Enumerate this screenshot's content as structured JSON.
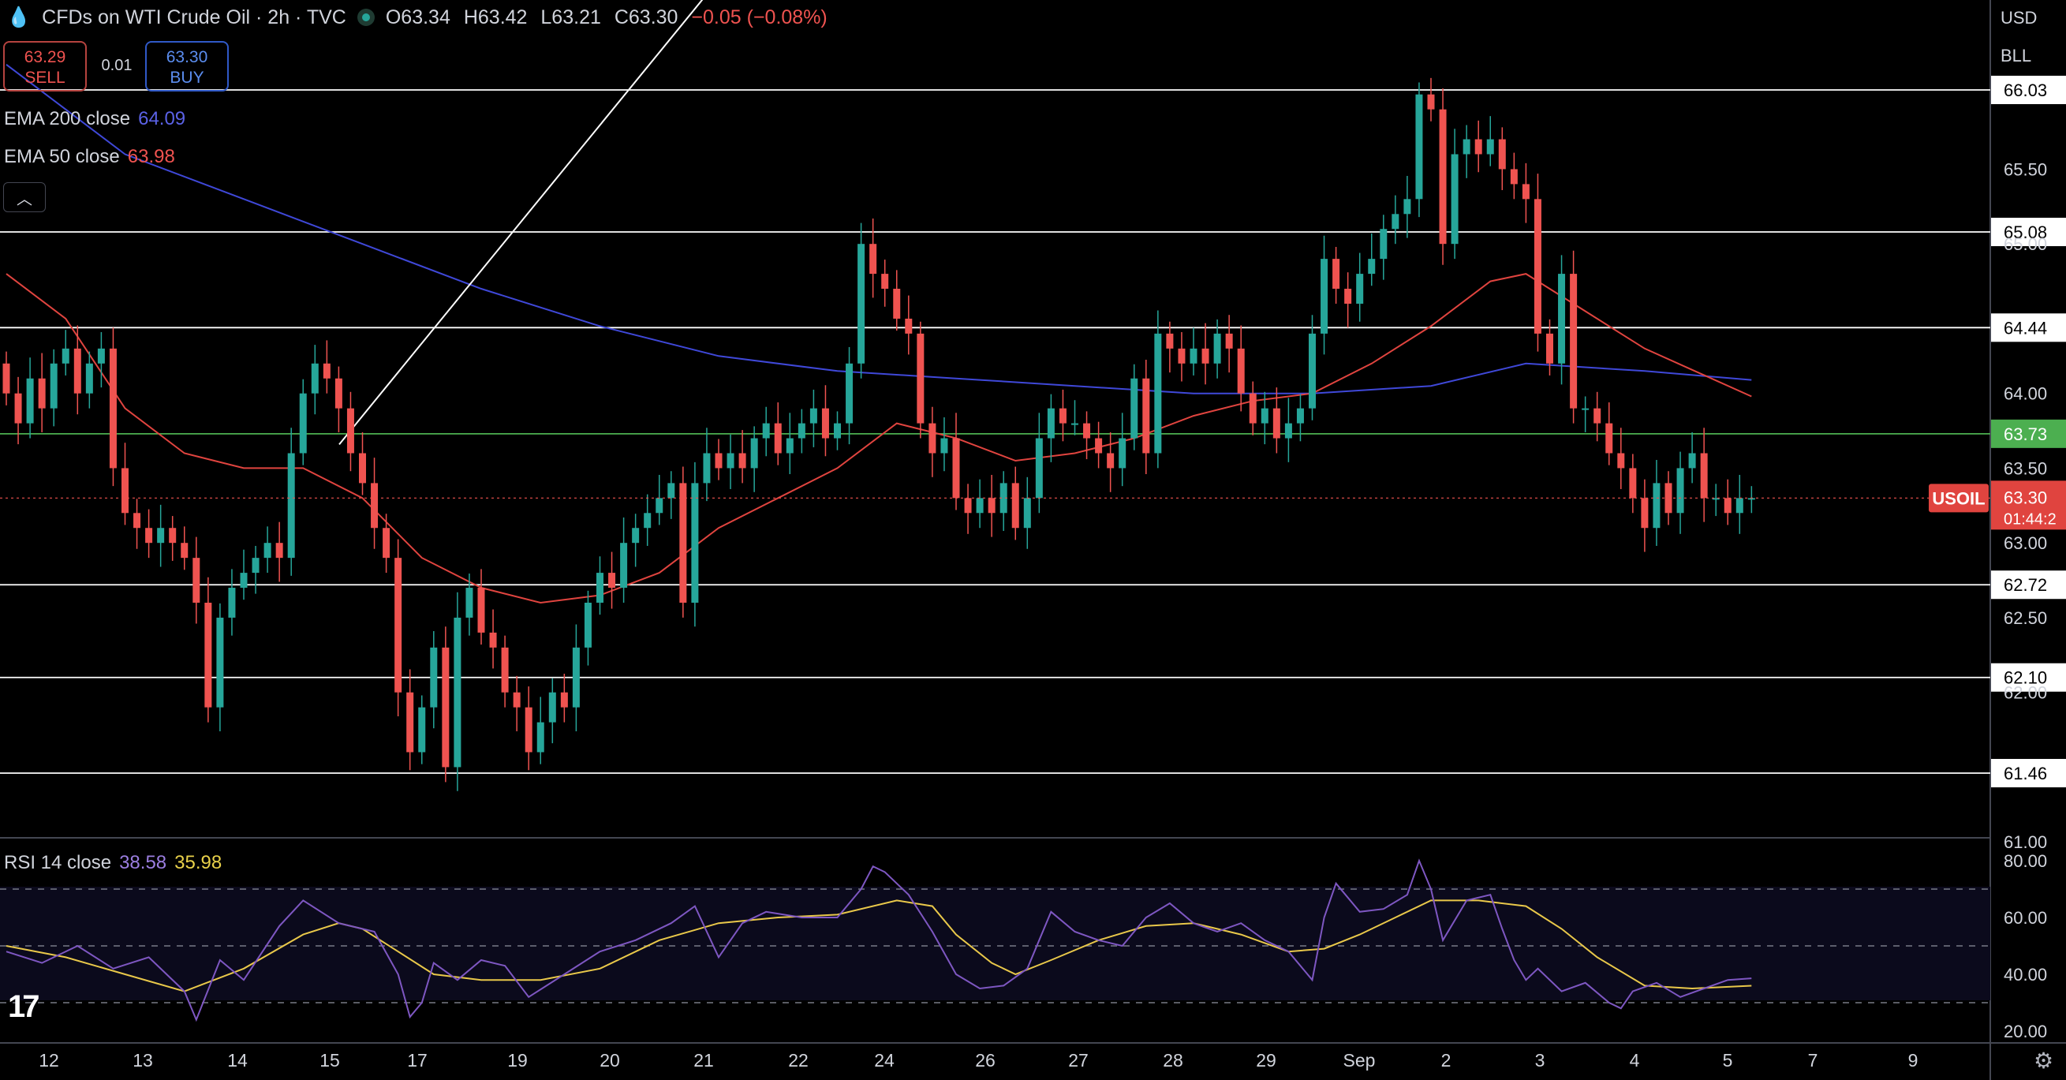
{
  "header": {
    "title": "CFDs on WTI Crude Oil · 2h · TVC",
    "open": "O63.34",
    "high": "H63.42",
    "low": "L63.21",
    "close": "C63.30",
    "change": "−0.05 (−0.08%)"
  },
  "trade": {
    "sell_price": "63.29",
    "sell_label": "SELL",
    "spread": "0.01",
    "buy_price": "63.30",
    "buy_label": "BUY"
  },
  "indicators": {
    "ema200": {
      "label": "EMA 200 close",
      "value": "64.09"
    },
    "ema50": {
      "label": "EMA 50 close",
      "value": "63.98"
    },
    "rsi": {
      "label": "RSI 14 close",
      "value": "38.58",
      "ma": "35.98"
    }
  },
  "axis_top": {
    "currency": "USD",
    "unit": "BLL"
  },
  "colors": {
    "up": "#26a69a",
    "down": "#ef5350",
    "ema200": "#3f48d8",
    "ema50": "#e0443f",
    "rsi": "#7e57c2",
    "rsi_ma": "#e9c84a",
    "support": "#4caf50"
  },
  "chart_data": {
    "type": "candlestick",
    "symbol": "USOIL",
    "last_price": "63.30",
    "countdown": "01:44:2",
    "price_ticks": [
      "65.50",
      "65.00",
      "64.00",
      "63.50",
      "63.00",
      "62.50",
      "62.00",
      "61.00"
    ],
    "rsi_ticks": [
      "80.00",
      "60.00",
      "40.00",
      "20.00"
    ],
    "rsi_levels": [
      70,
      50,
      30
    ],
    "levels": [
      {
        "value": "66.03",
        "y": 66.03,
        "color": "#ffffff"
      },
      {
        "value": "65.08",
        "y": 65.08,
        "color": "#ffffff"
      },
      {
        "value": "64.44",
        "y": 64.44,
        "color": "#ffffff"
      },
      {
        "value": "63.73",
        "y": 63.73,
        "color": "#4caf50"
      },
      {
        "value": "62.72",
        "y": 62.72,
        "color": "#ffffff"
      },
      {
        "value": "62.10",
        "y": 62.1,
        "color": "#ffffff"
      },
      {
        "value": "61.46",
        "y": 61.46,
        "color": "#ffffff"
      }
    ],
    "x_labels": [
      "12",
      "13",
      "14",
      "15",
      "17",
      "19",
      "20",
      "21",
      "22",
      "24",
      "26",
      "27",
      "28",
      "29",
      "Sep",
      "2",
      "3",
      "4",
      "5",
      "7",
      "9"
    ],
    "trendline": [
      [
        0.5,
        60.98
      ],
      [
        44.4,
        65.25
      ]
    ],
    "candles": [
      [
        64.2,
        64.0
      ],
      [
        64.0,
        63.8
      ],
      [
        63.8,
        64.1
      ],
      [
        64.1,
        63.9
      ],
      [
        63.9,
        64.2
      ],
      [
        64.2,
        64.3
      ],
      [
        64.3,
        64.0
      ],
      [
        64.0,
        64.2
      ],
      [
        64.2,
        64.3
      ],
      [
        64.3,
        63.5
      ],
      [
        63.5,
        63.2
      ],
      [
        63.2,
        63.1
      ],
      [
        63.1,
        63.0
      ],
      [
        63.0,
        63.1
      ],
      [
        63.1,
        63.0
      ],
      [
        63.0,
        62.9
      ],
      [
        62.9,
        62.6
      ],
      [
        62.6,
        61.9
      ],
      [
        61.9,
        62.5
      ],
      [
        62.5,
        62.7
      ],
      [
        62.7,
        62.8
      ],
      [
        62.8,
        62.9
      ],
      [
        62.9,
        63.0
      ],
      [
        63.0,
        62.9
      ],
      [
        62.9,
        63.6
      ],
      [
        63.6,
        64.0
      ],
      [
        64.0,
        64.2
      ],
      [
        64.2,
        64.1
      ],
      [
        64.1,
        63.9
      ],
      [
        63.9,
        63.6
      ],
      [
        63.6,
        63.4
      ],
      [
        63.4,
        63.1
      ],
      [
        63.1,
        62.9
      ],
      [
        62.9,
        62.0
      ],
      [
        62.0,
        61.6
      ],
      [
        61.6,
        61.9
      ],
      [
        61.9,
        62.3
      ],
      [
        62.3,
        61.5
      ],
      [
        61.5,
        62.5
      ],
      [
        62.5,
        62.7
      ],
      [
        62.7,
        62.4
      ],
      [
        62.4,
        62.3
      ],
      [
        62.3,
        62.0
      ],
      [
        62.0,
        61.9
      ],
      [
        61.9,
        61.6
      ],
      [
        61.6,
        61.8
      ],
      [
        61.8,
        62.0
      ],
      [
        62.0,
        61.9
      ],
      [
        61.9,
        62.3
      ],
      [
        62.3,
        62.6
      ],
      [
        62.6,
        62.8
      ],
      [
        62.8,
        62.7
      ],
      [
        62.7,
        63.0
      ],
      [
        63.0,
        63.1
      ],
      [
        63.1,
        63.2
      ],
      [
        63.2,
        63.3
      ],
      [
        63.3,
        63.4
      ],
      [
        63.4,
        62.6
      ],
      [
        62.6,
        63.4
      ],
      [
        63.4,
        63.6
      ],
      [
        63.6,
        63.5
      ],
      [
        63.5,
        63.6
      ],
      [
        63.6,
        63.5
      ],
      [
        63.5,
        63.7
      ],
      [
        63.7,
        63.8
      ],
      [
        63.8,
        63.6
      ],
      [
        63.6,
        63.7
      ],
      [
        63.7,
        63.8
      ],
      [
        63.8,
        63.9
      ],
      [
        63.9,
        63.7
      ],
      [
        63.7,
        63.8
      ],
      [
        63.8,
        64.2
      ],
      [
        64.2,
        65.0
      ],
      [
        65.0,
        64.8
      ],
      [
        64.8,
        64.7
      ],
      [
        64.7,
        64.5
      ],
      [
        64.5,
        64.4
      ],
      [
        64.4,
        63.8
      ],
      [
        63.8,
        63.6
      ],
      [
        63.6,
        63.7
      ],
      [
        63.7,
        63.3
      ],
      [
        63.3,
        63.2
      ],
      [
        63.2,
        63.3
      ],
      [
        63.3,
        63.2
      ],
      [
        63.2,
        63.4
      ],
      [
        63.4,
        63.1
      ],
      [
        63.1,
        63.3
      ],
      [
        63.3,
        63.7
      ],
      [
        63.7,
        63.9
      ],
      [
        63.9,
        63.8
      ],
      [
        63.8,
        63.8
      ],
      [
        63.8,
        63.7
      ],
      [
        63.7,
        63.6
      ],
      [
        63.6,
        63.5
      ],
      [
        63.5,
        63.7
      ],
      [
        63.7,
        64.1
      ],
      [
        64.1,
        63.6
      ],
      [
        63.6,
        64.4
      ],
      [
        64.4,
        64.3
      ],
      [
        64.3,
        64.2
      ],
      [
        64.2,
        64.3
      ],
      [
        64.3,
        64.2
      ],
      [
        64.2,
        64.4
      ],
      [
        64.4,
        64.3
      ],
      [
        64.3,
        64.0
      ],
      [
        64.0,
        63.8
      ],
      [
        63.8,
        63.9
      ],
      [
        63.9,
        63.7
      ],
      [
        63.7,
        63.8
      ],
      [
        63.8,
        63.9
      ],
      [
        63.9,
        64.4
      ],
      [
        64.4,
        64.9
      ],
      [
        64.9,
        64.7
      ],
      [
        64.7,
        64.6
      ],
      [
        64.6,
        64.8
      ],
      [
        64.8,
        64.9
      ],
      [
        64.9,
        65.1
      ],
      [
        65.1,
        65.2
      ],
      [
        65.2,
        65.3
      ],
      [
        65.3,
        66.0
      ],
      [
        66.0,
        65.9
      ],
      [
        65.9,
        65.0
      ],
      [
        65.0,
        65.6
      ],
      [
        65.6,
        65.7
      ],
      [
        65.7,
        65.6
      ],
      [
        65.6,
        65.7
      ],
      [
        65.7,
        65.5
      ],
      [
        65.5,
        65.4
      ],
      [
        65.4,
        65.3
      ],
      [
        65.3,
        64.4
      ],
      [
        64.4,
        64.2
      ],
      [
        64.2,
        64.8
      ],
      [
        64.8,
        63.9
      ],
      [
        63.9,
        63.9
      ],
      [
        63.9,
        63.8
      ],
      [
        63.8,
        63.6
      ],
      [
        63.6,
        63.5
      ],
      [
        63.5,
        63.3
      ],
      [
        63.3,
        63.1
      ],
      [
        63.1,
        63.4
      ],
      [
        63.4,
        63.2
      ],
      [
        63.2,
        63.5
      ],
      [
        63.5,
        63.6
      ],
      [
        63.6,
        63.3
      ],
      [
        63.3,
        63.3
      ],
      [
        63.3,
        63.2
      ],
      [
        63.2,
        63.3
      ],
      [
        63.3,
        63.3
      ]
    ],
    "ema50_points": [
      [
        0,
        64.8
      ],
      [
        5,
        64.5
      ],
      [
        10,
        63.9
      ],
      [
        15,
        63.6
      ],
      [
        20,
        63.5
      ],
      [
        25,
        63.5
      ],
      [
        30,
        63.3
      ],
      [
        35,
        62.9
      ],
      [
        40,
        62.7
      ],
      [
        45,
        62.6
      ],
      [
        50,
        62.65
      ],
      [
        55,
        62.8
      ],
      [
        60,
        63.1
      ],
      [
        65,
        63.3
      ],
      [
        70,
        63.5
      ],
      [
        75,
        63.8
      ],
      [
        80,
        63.7
      ],
      [
        85,
        63.55
      ],
      [
        90,
        63.6
      ],
      [
        95,
        63.7
      ],
      [
        100,
        63.85
      ],
      [
        105,
        63.95
      ],
      [
        110,
        64.0
      ],
      [
        115,
        64.2
      ],
      [
        120,
        64.45
      ],
      [
        125,
        64.75
      ],
      [
        128,
        64.8
      ],
      [
        132,
        64.6
      ],
      [
        138,
        64.3
      ],
      [
        147,
        63.98
      ]
    ],
    "ema200_points": [
      [
        0,
        66.2
      ],
      [
        10,
        65.6
      ],
      [
        20,
        65.3
      ],
      [
        30,
        65.0
      ],
      [
        40,
        64.7
      ],
      [
        50,
        64.45
      ],
      [
        60,
        64.25
      ],
      [
        70,
        64.15
      ],
      [
        80,
        64.1
      ],
      [
        90,
        64.05
      ],
      [
        100,
        64.0
      ],
      [
        110,
        64.0
      ],
      [
        120,
        64.05
      ],
      [
        128,
        64.2
      ],
      [
        138,
        64.15
      ],
      [
        147,
        64.09
      ]
    ],
    "rsi_points": [
      [
        0,
        48
      ],
      [
        3,
        44
      ],
      [
        6,
        50
      ],
      [
        9,
        42
      ],
      [
        12,
        46
      ],
      [
        15,
        34
      ],
      [
        16,
        24
      ],
      [
        18,
        45
      ],
      [
        20,
        38
      ],
      [
        23,
        57
      ],
      [
        25,
        66
      ],
      [
        28,
        58
      ],
      [
        31,
        55
      ],
      [
        33,
        40
      ],
      [
        34,
        25
      ],
      [
        35,
        30
      ],
      [
        36,
        44
      ],
      [
        38,
        38
      ],
      [
        40,
        45
      ],
      [
        42,
        43
      ],
      [
        44,
        32
      ],
      [
        47,
        40
      ],
      [
        50,
        48
      ],
      [
        53,
        52
      ],
      [
        56,
        58
      ],
      [
        58,
        64
      ],
      [
        60,
        46
      ],
      [
        62,
        58
      ],
      [
        64,
        62
      ],
      [
        67,
        60
      ],
      [
        70,
        60
      ],
      [
        72,
        70
      ],
      [
        73,
        78
      ],
      [
        74,
        76
      ],
      [
        76,
        68
      ],
      [
        78,
        55
      ],
      [
        80,
        40
      ],
      [
        82,
        35
      ],
      [
        84,
        36
      ],
      [
        86,
        42
      ],
      [
        88,
        62
      ],
      [
        90,
        55
      ],
      [
        92,
        52
      ],
      [
        94,
        50
      ],
      [
        96,
        60
      ],
      [
        98,
        65
      ],
      [
        100,
        58
      ],
      [
        102,
        55
      ],
      [
        104,
        58
      ],
      [
        106,
        52
      ],
      [
        108,
        48
      ],
      [
        110,
        38
      ],
      [
        111,
        60
      ],
      [
        112,
        72
      ],
      [
        114,
        62
      ],
      [
        116,
        63
      ],
      [
        118,
        68
      ],
      [
        119,
        80
      ],
      [
        120,
        70
      ],
      [
        121,
        52
      ],
      [
        123,
        66
      ],
      [
        125,
        68
      ],
      [
        126,
        56
      ],
      [
        127,
        45
      ],
      [
        128,
        38
      ],
      [
        129,
        42
      ],
      [
        131,
        34
      ],
      [
        133,
        37
      ],
      [
        135,
        30
      ],
      [
        136,
        28
      ],
      [
        137,
        34
      ],
      [
        139,
        37
      ],
      [
        141,
        32
      ],
      [
        143,
        35
      ],
      [
        145,
        38
      ],
      [
        147,
        38.58
      ]
    ],
    "rsi_ma_points": [
      [
        0,
        50
      ],
      [
        5,
        46
      ],
      [
        10,
        40
      ],
      [
        15,
        34
      ],
      [
        20,
        42
      ],
      [
        25,
        54
      ],
      [
        28,
        58
      ],
      [
        30,
        56
      ],
      [
        33,
        48
      ],
      [
        36,
        40
      ],
      [
        40,
        38
      ],
      [
        45,
        38
      ],
      [
        50,
        42
      ],
      [
        55,
        52
      ],
      [
        60,
        58
      ],
      [
        65,
        60
      ],
      [
        70,
        61
      ],
      [
        75,
        66
      ],
      [
        78,
        64
      ],
      [
        80,
        54
      ],
      [
        83,
        44
      ],
      [
        85,
        40
      ],
      [
        88,
        45
      ],
      [
        92,
        52
      ],
      [
        96,
        57
      ],
      [
        100,
        58
      ],
      [
        104,
        54
      ],
      [
        108,
        48
      ],
      [
        111,
        49
      ],
      [
        114,
        54
      ],
      [
        117,
        60
      ],
      [
        120,
        66
      ],
      [
        124,
        66
      ],
      [
        128,
        64
      ],
      [
        131,
        56
      ],
      [
        134,
        46
      ],
      [
        138,
        36
      ],
      [
        142,
        35
      ],
      [
        147,
        35.98
      ]
    ]
  }
}
